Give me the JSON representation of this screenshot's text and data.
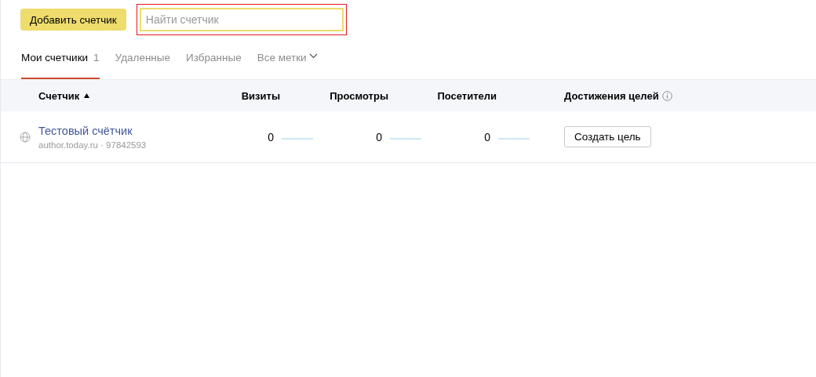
{
  "toolbar": {
    "add_button": "Добавить счетчик",
    "search": {
      "placeholder": "Найти счетчик",
      "highlighted": true
    }
  },
  "tabs": [
    {
      "label": "Мои счетчики",
      "count": "1",
      "selected": true
    },
    {
      "label": "Удаленные",
      "selected": false
    },
    {
      "label": "Избранные",
      "selected": false
    },
    {
      "label": "Все метки",
      "kind": "dropdown",
      "selected": false
    }
  ],
  "table": {
    "columns": [
      {
        "label": "Счетчик",
        "sort_ascending": true
      },
      {
        "label": "Визиты"
      },
      {
        "label": "Просмотры"
      },
      {
        "label": "Посетители"
      },
      {
        "label": "Достижения целей",
        "info": true
      }
    ],
    "rows": [
      {
        "name": "Тестовый счётчик",
        "site": "author.today.ru · 97842593",
        "visits": "0",
        "views": "0",
        "visitors": "0",
        "goal_button": "Создать цель"
      }
    ]
  }
}
